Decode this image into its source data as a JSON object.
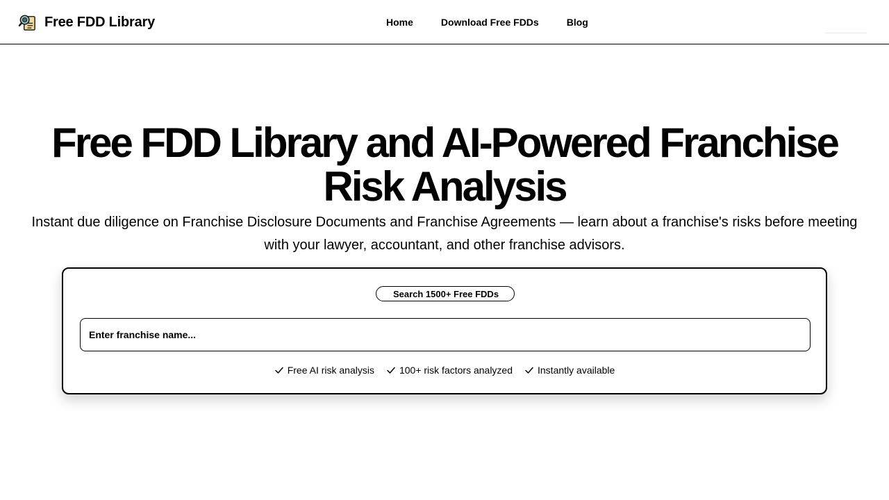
{
  "nav": {
    "brand": "Free FDD Library",
    "logo_icon": "magnifier-document-icon",
    "links": [
      "Home",
      "Download Free FDDs",
      "Blog"
    ]
  },
  "hero": {
    "title_line1": "Free FDD Library and AI-Powered Franchise",
    "title_line2": "Risk Analysis",
    "subtitle": "Instant due diligence on Franchise Disclosure Documents and Franchise Agreements — learn about a franchise's risks before meeting with your lawyer, accountant, and other franchise advisors."
  },
  "search": {
    "badge_icon": "",
    "badge_label": "Search 1500+ Free FDDs",
    "placeholder": "Enter franchise name...",
    "value": "",
    "features": [
      "Free AI risk analysis",
      "100+ risk factors analyzed",
      "Instantly available"
    ]
  },
  "colors": {
    "text": "#000000",
    "background": "#ffffff",
    "border": "#000000"
  }
}
